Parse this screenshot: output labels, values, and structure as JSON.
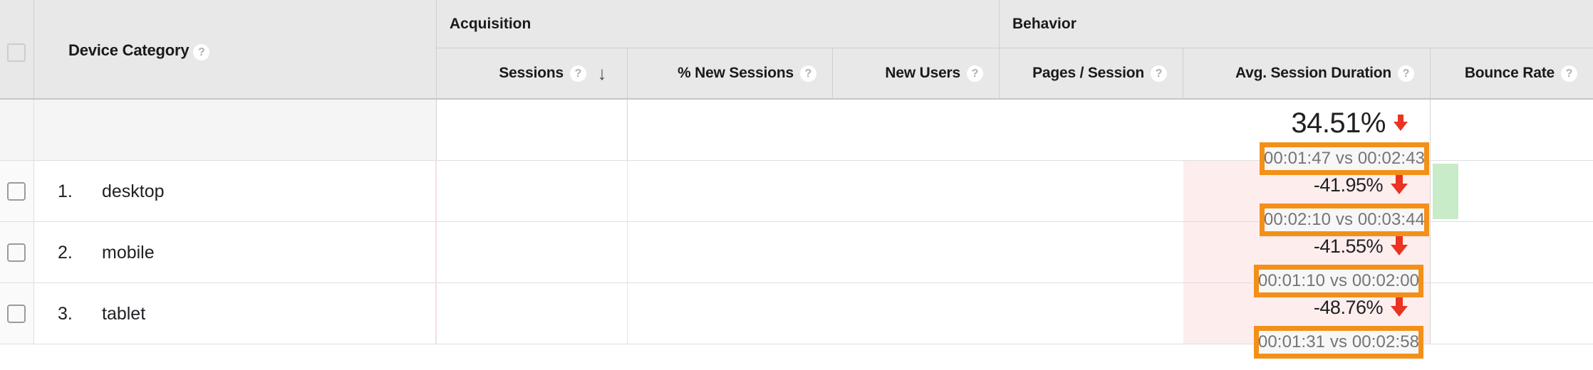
{
  "table": {
    "dimension_header": {
      "label": "Device Category",
      "help_icon": "help-question-icon",
      "help_glyph": "?"
    },
    "select_all_checkbox": "",
    "groups": [
      {
        "id": "acquisition",
        "label": "Acquisition"
      },
      {
        "id": "behavior",
        "label": "Behavior"
      }
    ],
    "metrics": [
      {
        "id": "sessions",
        "label": "Sessions",
        "help_glyph": "?",
        "sorted": true,
        "sort_glyph": "↓"
      },
      {
        "id": "pct_new_sessions",
        "label": "% New Sessions",
        "help_glyph": "?",
        "sorted": false
      },
      {
        "id": "new_users",
        "label": "New Users",
        "help_glyph": "?",
        "sorted": false
      },
      {
        "id": "pages_per_session",
        "label": "Pages / Session",
        "help_glyph": "?",
        "sorted": false
      },
      {
        "id": "avg_session_duration",
        "label": "Avg. Session Duration",
        "help_glyph": "?",
        "sorted": false
      },
      {
        "id": "bounce_rate",
        "label": "Bounce Rate",
        "help_glyph": "?",
        "sorted": false
      }
    ],
    "summary_row": {
      "index": "",
      "name": "",
      "avg_session_duration": {
        "percent": "34.51%",
        "direction": "down",
        "comparison": "00:01:47 vs 00:02:43"
      }
    },
    "rows": [
      {
        "index": "1.",
        "name": "desktop",
        "avg_session_duration": {
          "percent": "-41.95%",
          "direction": "down",
          "comparison": "00:02:10 vs 00:03:44"
        }
      },
      {
        "index": "2.",
        "name": "mobile",
        "avg_session_duration": {
          "percent": "-41.55%",
          "direction": "down",
          "comparison": "00:01:10 vs 00:02:00"
        }
      },
      {
        "index": "3.",
        "name": "tablet",
        "avg_session_duration": {
          "percent": "-48.76%",
          "direction": "down",
          "comparison": "00:01:31 vs 00:02:58"
        }
      }
    ]
  },
  "colors": {
    "annotation_orange": "#f39019",
    "negative_red": "#ea3323",
    "negative_cell_bg": "#fdeded",
    "positive_bar_green": "#c8ecc8",
    "header_bg": "#e8e8e8",
    "comparison_text": "#757575"
  }
}
